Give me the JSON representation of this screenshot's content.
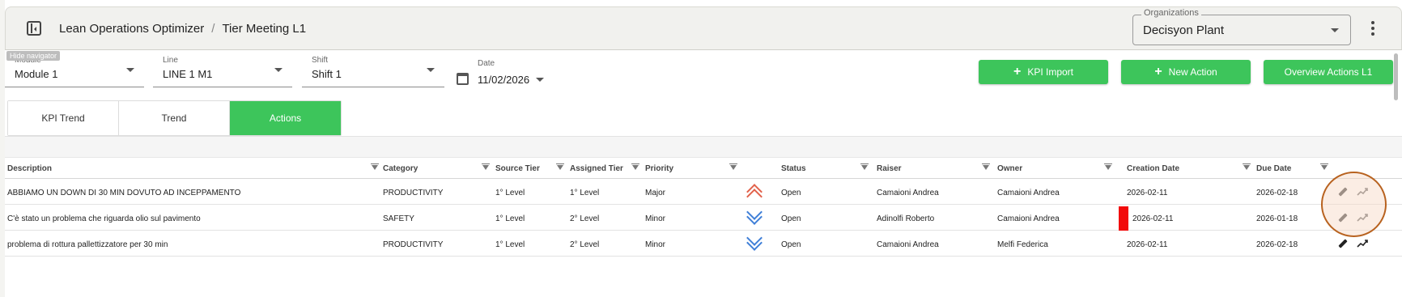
{
  "header": {
    "app_name": "Lean Operations Optimizer",
    "separator": "/",
    "page_name": "Tier Meeting L1",
    "organization": {
      "label": "Organizations",
      "value": "Decisyon Plant"
    }
  },
  "filters": {
    "hide_navigator_tip": "Hide navigator",
    "module": {
      "label": "Module",
      "value": "Module 1"
    },
    "line": {
      "label": "Line",
      "value": "LINE 1 M1"
    },
    "shift": {
      "label": "Shift",
      "value": "Shift 1"
    },
    "date": {
      "label": "Date",
      "value": "11/02/2026"
    }
  },
  "buttons": {
    "kpi_import": "KPI Import",
    "new_action": "New Action",
    "overview_actions": "Overview Actions L1",
    "plus": "+"
  },
  "tabs": [
    {
      "label": "KPI Trend",
      "active": false
    },
    {
      "label": "Trend",
      "active": false
    },
    {
      "label": "Actions",
      "active": true
    }
  ],
  "table": {
    "columns": [
      "Description",
      "Category",
      "Source Tier",
      "Assigned Tier",
      "Priority",
      "Status",
      "Raiser",
      "Owner",
      "Creation Date",
      "Due Date"
    ],
    "rows": [
      {
        "description": "ABBIAMO UN DOWN DI 30 MIN DOVUTO AD INCEPPAMENTO",
        "category": "PRODUCTIVITY",
        "source_tier": "1° Level",
        "assigned_tier": "1° Level",
        "priority": "Major",
        "priority_icon": "double-chevron-up-icon",
        "status": "Open",
        "raiser": "Camaioni Andrea",
        "owner": "Camaioni Andrea",
        "creation_date": "2026-02-11",
        "due_date": "2026-02-18",
        "overdue": false
      },
      {
        "description": "C'è stato un problema che riguarda olio sul pavimento",
        "category": "SAFETY",
        "source_tier": "1° Level",
        "assigned_tier": "2° Level",
        "priority": "Minor",
        "priority_icon": "double-chevron-down-icon",
        "status": "Open",
        "raiser": "Adinolfi Roberto",
        "owner": "Camaioni Andrea",
        "creation_date": "2026-02-11",
        "due_date": "2026-01-18",
        "overdue": true
      },
      {
        "description": "problema di rottura pallettizzatore per 30 min",
        "category": "PRODUCTIVITY",
        "source_tier": "1° Level",
        "assigned_tier": "2° Level",
        "priority": "Minor",
        "priority_icon": "double-chevron-down-icon",
        "status": "Open",
        "raiser": "Camaioni Andrea",
        "owner": "Melfi Federica",
        "creation_date": "2026-02-11",
        "due_date": "2026-02-18",
        "overdue": false
      }
    ]
  },
  "colors": {
    "accent_green": "#3dc55b",
    "priority_major": "#e2624b",
    "priority_minor": "#3f7fd8",
    "overdue_flag": "#f20a0a",
    "highlight_ring": "#b8621f"
  }
}
